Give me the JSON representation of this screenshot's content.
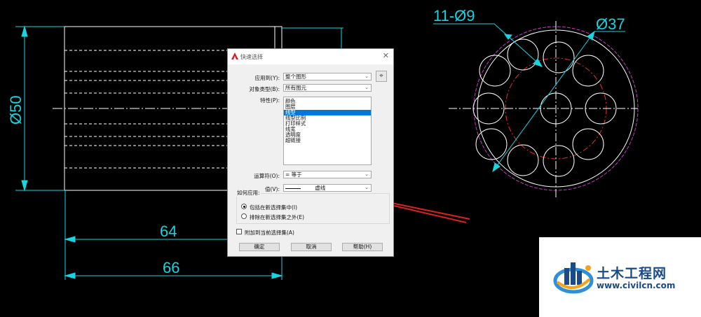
{
  "drawing": {
    "dim_dia50": "Ø50",
    "dim_64": "64",
    "dim_66": "66",
    "dim_holes": "11-Ø9",
    "dim_dia37": "Ø37",
    "line_color": "#ffffff",
    "dim_color": "#19d3e0",
    "center_line_color": "#e03030",
    "outer_circle_color": "#c040c0",
    "arrow_color": "#e02020"
  },
  "dialog": {
    "title": "快速选择",
    "apply_to_label": "应用到(Y):",
    "apply_to_value": "整个图形",
    "object_type_label": "对象类型(B):",
    "object_type_value": "所有图元",
    "properties_label": "特性(P):",
    "properties": [
      "颜色",
      "图层",
      "线型",
      "线型比例",
      "打印样式",
      "线宽",
      "透明度",
      "超链接"
    ],
    "selected_property": "线型",
    "operator_label": "运算符(O):",
    "operator_value": "= 等于",
    "value_label": "值(V):",
    "value_value": "虚线",
    "how_apply_label": "如何应用:",
    "include_option": "包括在新选择集中(I)",
    "exclude_option": "排除在新选择集之外(E)",
    "append_label": "附加到当前选择集(A)",
    "ok_button": "确定",
    "cancel_button": "取消",
    "help_button": "帮助(H)"
  },
  "watermark": {
    "title": "土木工程网",
    "url": "www.civilcn.com"
  }
}
